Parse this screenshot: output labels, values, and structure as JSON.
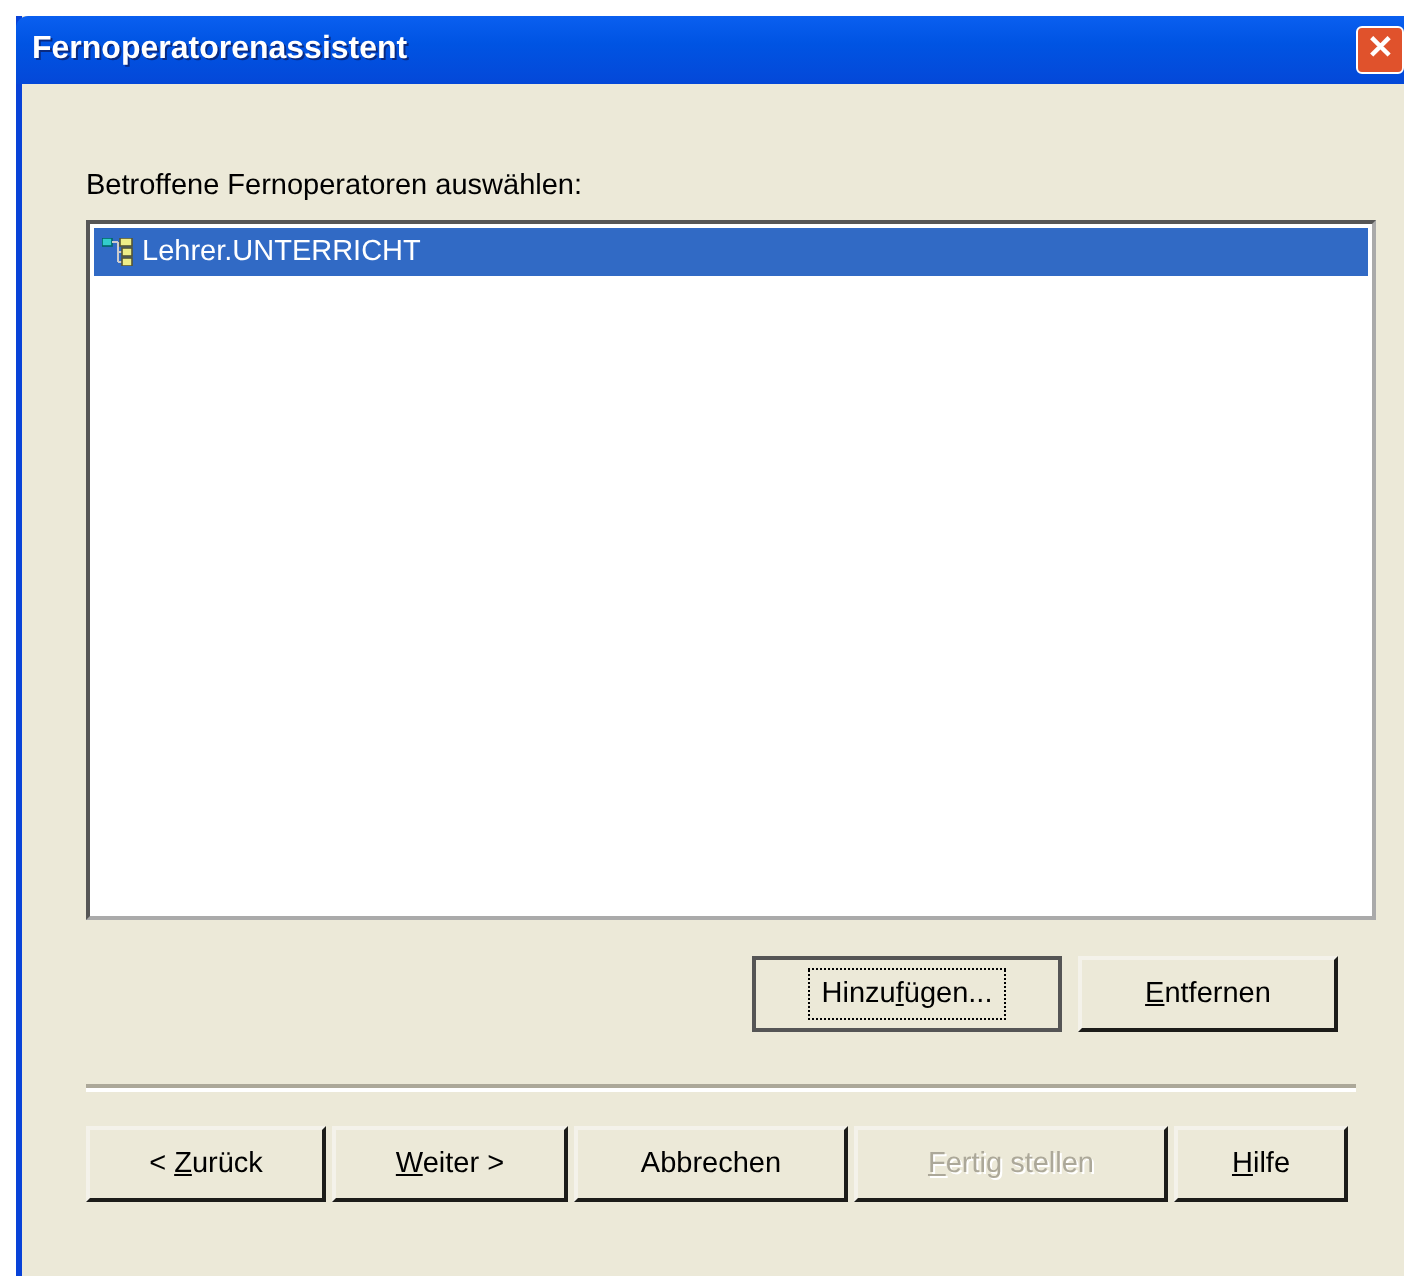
{
  "window": {
    "title": "Fernoperatorenassistent",
    "close": "✕"
  },
  "list": {
    "label": "Betroffene Fernoperatoren auswählen:",
    "items": [
      {
        "text": "Lehrer.UNTERRICHT",
        "selected": true
      }
    ]
  },
  "list_buttons": [
    {
      "pre": "Hinzu",
      "key": "f",
      "post": "ügen...",
      "focused": true,
      "disabled": false
    },
    {
      "key": "E",
      "post": "ntfernen",
      "focused": false,
      "disabled": false
    }
  ],
  "nav_buttons": [
    {
      "pre": "< ",
      "key": "Z",
      "post": "urück",
      "focused": false,
      "disabled": false
    },
    {
      "key": "W",
      "post": "eiter >",
      "focused": false,
      "disabled": false
    },
    {
      "pre": "Abbrechen",
      "focused": false,
      "disabled": false
    },
    {
      "key": "F",
      "post": "ertig stellen",
      "focused": false,
      "disabled": true
    },
    {
      "key": "H",
      "post": "ilfe",
      "focused": false,
      "disabled": false
    }
  ]
}
